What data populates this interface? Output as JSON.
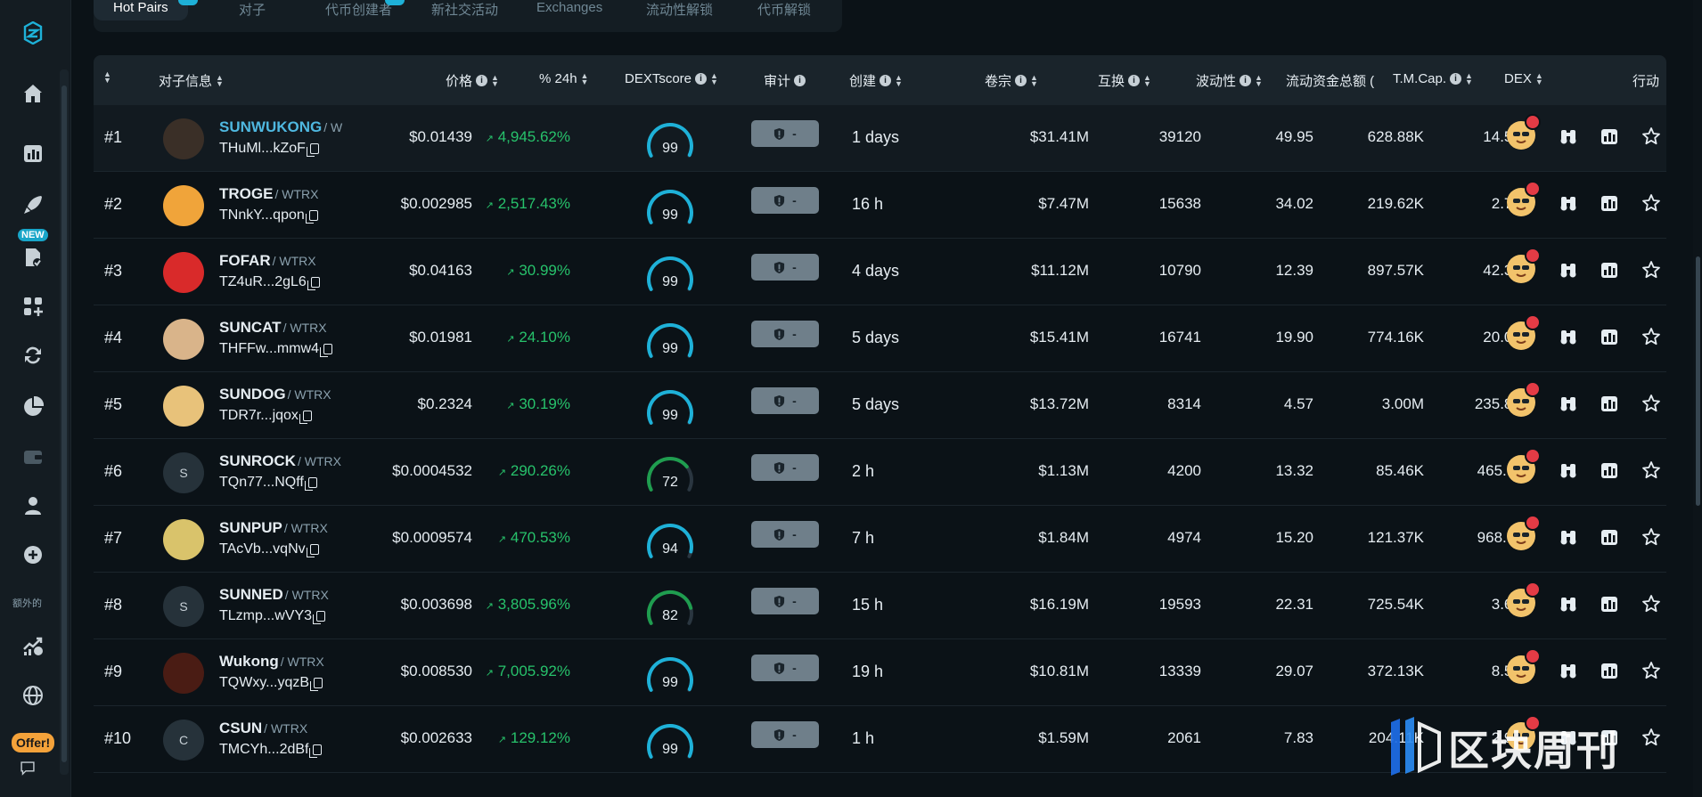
{
  "tabs": [
    {
      "label": "Hot Pairs",
      "active": true
    },
    {
      "label": "对子"
    },
    {
      "label": "代币创建者"
    },
    {
      "label": "新社交活动"
    },
    {
      "label": "Exchanges"
    },
    {
      "label": "流动性解锁"
    },
    {
      "label": "代币解锁"
    }
  ],
  "sidebar": {
    "new_badge": "NEW",
    "extra_label": "额外的",
    "offer_label": "Offer!",
    "icons": [
      "logo-icon",
      "home-icon",
      "chart-icon",
      "rocket-icon",
      "doc-icon",
      "apps-icon",
      "swap-icon",
      "pie-icon",
      "wallet-icon",
      "user-icon",
      "add-icon",
      "stats-icon",
      "globe-icon",
      "chat-icon"
    ]
  },
  "table": {
    "headers": {
      "pair_info": "对子信息",
      "price": "价格",
      "change24h": "% 24h",
      "dextscore": "DEXTscore",
      "audit": "审计",
      "created": "创建",
      "volume": "卷宗",
      "swaps": "互换",
      "volatility": "波动性",
      "liquidity": "流动资金总额 (",
      "mcap": "T.M.Cap.",
      "dex": "DEX",
      "actions": "行动"
    },
    "audit_dash": "-",
    "rows": [
      {
        "rank": "#1",
        "avatar": "",
        "symbol": "SUNWUKONG",
        "pair": "/ W",
        "addr": "THuMl...kZoF",
        "price": "$0.01439",
        "change": "4,945.62%",
        "score": "99",
        "created": "1 days",
        "volume": "$31.41M",
        "swaps": "39120",
        "volatility": "49.95",
        "liquidity": "628.88K",
        "mcap": "14.56M"
      },
      {
        "rank": "#2",
        "avatar": "",
        "symbol": "TROGE",
        "pair": "/ WTRX",
        "addr": "TNnkY...qpon",
        "price": "$0.002985",
        "change": "2,517.43%",
        "score": "99",
        "created": "16 h",
        "volume": "$7.47M",
        "swaps": "15638",
        "volatility": "34.02",
        "liquidity": "219.62K",
        "mcap": "2.72M"
      },
      {
        "rank": "#3",
        "avatar": "",
        "symbol": "FOFAR",
        "pair": "/ WTRX",
        "addr": "TZ4uR...2gL6",
        "price": "$0.04163",
        "change": "30.99%",
        "score": "99",
        "created": "4 days",
        "volume": "$11.12M",
        "swaps": "10790",
        "volatility": "12.39",
        "liquidity": "897.57K",
        "mcap": "42.35M"
      },
      {
        "rank": "#4",
        "avatar": "",
        "symbol": "SUNCAT",
        "pair": "/ WTRX",
        "addr": "THFFw...mmw4",
        "price": "$0.01981",
        "change": "24.10%",
        "score": "99",
        "created": "5 days",
        "volume": "$15.41M",
        "swaps": "16741",
        "volatility": "19.90",
        "liquidity": "774.16K",
        "mcap": "20.07M"
      },
      {
        "rank": "#5",
        "avatar": "",
        "symbol": "SUNDOG",
        "pair": "/ WTRX",
        "addr": "TDR7r...jqox",
        "price": "$0.2324",
        "change": "30.19%",
        "score": "99",
        "created": "5 days",
        "volume": "$13.72M",
        "swaps": "8314",
        "volatility": "4.57",
        "liquidity": "3.00M",
        "mcap": "235.80M"
      },
      {
        "rank": "#6",
        "avatar": "S",
        "symbol": "SUNROCK",
        "pair": "/ WTRX",
        "addr": "TQn77...NQff",
        "price": "$0.0004532",
        "change": "290.26%",
        "score": "72",
        "created": "2 h",
        "volume": "$1.13M",
        "swaps": "4200",
        "volatility": "13.32",
        "liquidity": "85.46K",
        "mcap": "465.70K"
      },
      {
        "rank": "#7",
        "avatar": "",
        "symbol": "SUNPUP",
        "pair": "/ WTRX",
        "addr": "TAcVb...vqNv",
        "price": "$0.0009574",
        "change": "470.53%",
        "score": "94",
        "created": "7 h",
        "volume": "$1.84M",
        "swaps": "4974",
        "volatility": "15.20",
        "liquidity": "121.37K",
        "mcap": "968.05K"
      },
      {
        "rank": "#8",
        "avatar": "S",
        "symbol": "SUNNED",
        "pair": "/ WTRX",
        "addr": "TLzmp...wVY3",
        "price": "$0.003698",
        "change": "3,805.96%",
        "score": "82",
        "created": "15 h",
        "volume": "$16.19M",
        "swaps": "19593",
        "volatility": "22.31",
        "liquidity": "725.54K",
        "mcap": "3.66M"
      },
      {
        "rank": "#9",
        "avatar": "",
        "symbol": "Wukong",
        "pair": "/ WTRX",
        "addr": "TQWxy...yqzB",
        "price": "$0.008530",
        "change": "7,005.92%",
        "score": "99",
        "created": "19 h",
        "volume": "$10.81M",
        "swaps": "13339",
        "volatility": "29.07",
        "liquidity": "372.13K",
        "mcap": "8.57M"
      },
      {
        "rank": "#10",
        "avatar": "C",
        "symbol": "CSUN",
        "pair": "/ WTRX",
        "addr": "TMCYh...2dBf",
        "price": "$0.002633",
        "change": "129.12%",
        "score": "99",
        "created": "1 h",
        "volume": "$1.59M",
        "swaps": "2061",
        "volatility": "7.83",
        "liquidity": "204.11K",
        "mcap": "2.93M"
      }
    ]
  },
  "watermark": {
    "text": "区块周刊"
  },
  "colors": {
    "accent": "#18a5c8",
    "up": "#27c26b",
    "bg": "#0b1217",
    "gauge_good": "#1eb1d8",
    "gauge_mid": "#1f9d4f"
  }
}
